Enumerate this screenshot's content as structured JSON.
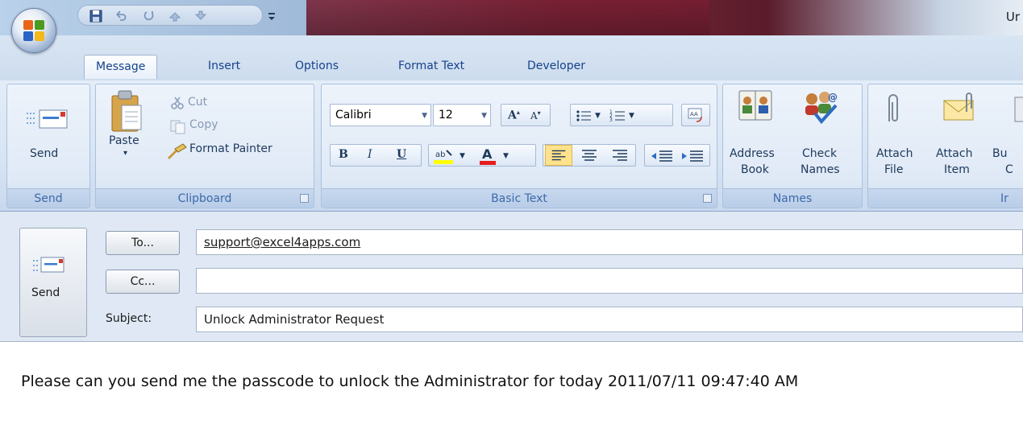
{
  "window": {
    "title": "Ur"
  },
  "tabs": [
    {
      "label": "Message",
      "active": true
    },
    {
      "label": "Insert"
    },
    {
      "label": "Options"
    },
    {
      "label": "Format Text"
    },
    {
      "label": "Developer"
    }
  ],
  "ribbon": {
    "send_group": {
      "button": "Send",
      "label": "Send"
    },
    "clipboard": {
      "label": "Clipboard",
      "paste": "Paste",
      "cut": "Cut",
      "copy": "Copy",
      "format_painter": "Format Painter"
    },
    "basic_text": {
      "label": "Basic Text",
      "font": "Calibri",
      "size": "12",
      "bold": "B",
      "italic": "I",
      "underline": "U"
    },
    "names": {
      "label": "Names",
      "address_book_1": "Address",
      "address_book_2": "Book",
      "check_names_1": "Check",
      "check_names_2": "Names"
    },
    "include": {
      "label": "Ir",
      "attach_file_1": "Attach",
      "attach_file_2": "File",
      "attach_item_1": "Attach",
      "attach_item_2": "Item",
      "bu_1": "Bu",
      "bu_2": "C"
    }
  },
  "compose": {
    "send": "Send",
    "to_button": "To...",
    "cc_button": "Cc...",
    "subject_label": "Subject:",
    "to_value": "support@excel4apps.com",
    "cc_value": "",
    "subject_value": "Unlock Administrator Request",
    "body": "Please can you send me the passcode to unlock the Administrator for today 2011/07/11 09:47:40 AM"
  },
  "colors": {
    "accent": "#15428b",
    "ribbon_bg": "#dfe9f6",
    "title_dark": "#7a2a3a"
  }
}
